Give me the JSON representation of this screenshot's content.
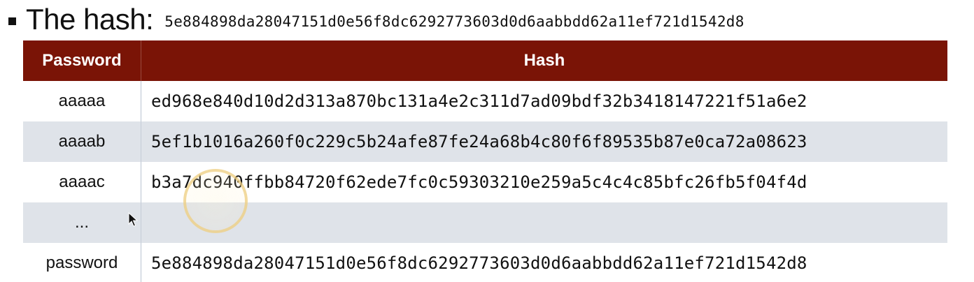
{
  "headline": {
    "label": "The hash:",
    "hash": "5e884898da28047151d0e56f8dc6292773603d0d6aabbdd62a11ef721d1542d8"
  },
  "table": {
    "headers": {
      "password": "Password",
      "hash": "Hash"
    },
    "rows": [
      {
        "password": "aaaaa",
        "hash": "ed968e840d10d2d313a870bc131a4e2c311d7ad09bdf32b3418147221f51a6e2"
      },
      {
        "password": "aaaab",
        "hash": "5ef1b1016a260f0c229c5b24afe87fe24a68b4c80f6f89535b87e0ca72a08623"
      },
      {
        "password": "aaaac",
        "hash": "b3a7dc940ffbb84720f62ede7fc0c59303210e259a5c4c4c85bfc26fb5f04f4d"
      },
      {
        "password": "...",
        "hash": ""
      },
      {
        "password": "password",
        "hash": "5e884898da28047151d0e56f8dc6292773603d0d6aabbdd62a11ef721d1542d8"
      }
    ]
  },
  "colors": {
    "header_background": "#7a1406",
    "stripe_background": "#dfe3e9"
  }
}
